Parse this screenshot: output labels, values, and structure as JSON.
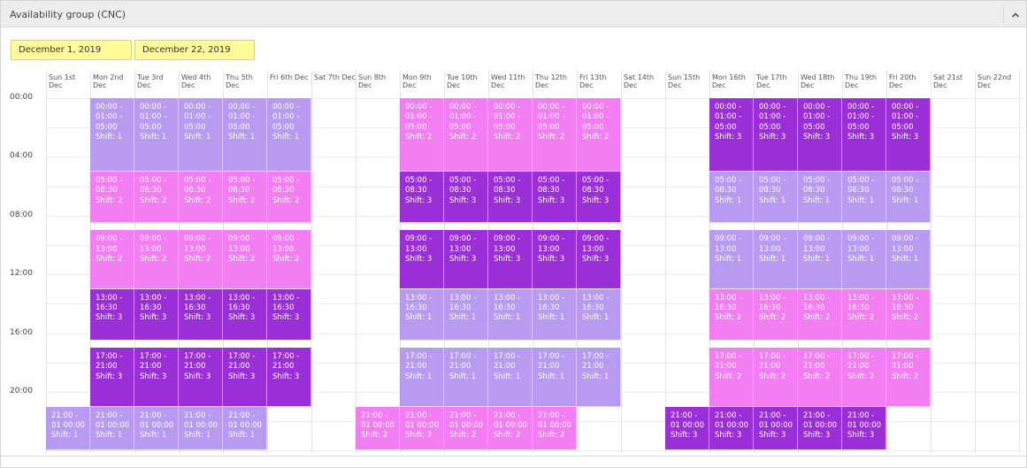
{
  "panel": {
    "title": "Availability group (CNC)"
  },
  "dates": {
    "start": "December 1, 2019",
    "end": "December 22, 2019"
  },
  "days": [
    "Sun 1st Dec",
    "Mon 2nd Dec",
    "Tue 3rd Dec",
    "Wed 4th Dec",
    "Thu 5th Dec",
    "Fri 6th Dec",
    "Sat 7th Dec",
    "Sun 8th Dec",
    "Mon 9th Dec",
    "Tue 10th Dec",
    "Wed 11th Dec",
    "Thu 12th Dec",
    "Fri 13th Dec",
    "Sat 14th Dec",
    "Sun 15th Dec",
    "Mon 16th Dec",
    "Tue 17th Dec",
    "Wed 18th Dec",
    "Thu 19th Dec",
    "Fri 20th Dec",
    "Sat 21st Dec",
    "Sun 22nd Dec"
  ],
  "time_labels": [
    "00:00",
    "04:00",
    "08:00",
    "12:00",
    "16:00",
    "20:00"
  ],
  "shift_colors": {
    "1": "#b99af1",
    "2": "#f37ef3",
    "3": "#9b2fd7"
  },
  "events": [
    {
      "day": 1,
      "s": 0,
      "e": 5,
      "l1": "00:00 -",
      "l2": "01:00 -",
      "l3": "05:00",
      "label": "Shift: 1",
      "shift": 1
    },
    {
      "day": 2,
      "s": 0,
      "e": 5,
      "l1": "00:00 -",
      "l2": "01:00 -",
      "l3": "05:00",
      "label": "Shift: 1",
      "shift": 1
    },
    {
      "day": 3,
      "s": 0,
      "e": 5,
      "l1": "00:00 -",
      "l2": "01:00 -",
      "l3": "05:00",
      "label": "Shift: 1",
      "shift": 1
    },
    {
      "day": 4,
      "s": 0,
      "e": 5,
      "l1": "00:00 -",
      "l2": "01:00 -",
      "l3": "05:00",
      "label": "Shift: 1",
      "shift": 1
    },
    {
      "day": 5,
      "s": 0,
      "e": 5,
      "l1": "00:00 -",
      "l2": "01:00 -",
      "l3": "05:00",
      "label": "Shift: 1",
      "shift": 1
    },
    {
      "day": 8,
      "s": 0,
      "e": 5,
      "l1": "00:00 -",
      "l2": "01:00 -",
      "l3": "05:00",
      "label": "Shift: 2",
      "shift": 2
    },
    {
      "day": 9,
      "s": 0,
      "e": 5,
      "l1": "00:00 -",
      "l2": "01:00 -",
      "l3": "05:00",
      "label": "Shift: 2",
      "shift": 2
    },
    {
      "day": 10,
      "s": 0,
      "e": 5,
      "l1": "00:00 -",
      "l2": "01:00 -",
      "l3": "05:00",
      "label": "Shift: 2",
      "shift": 2
    },
    {
      "day": 11,
      "s": 0,
      "e": 5,
      "l1": "00:00 -",
      "l2": "01:00 -",
      "l3": "05:00",
      "label": "Shift: 2",
      "shift": 2
    },
    {
      "day": 12,
      "s": 0,
      "e": 5,
      "l1": "00:00 -",
      "l2": "01:00 -",
      "l3": "05:00",
      "label": "Shift: 2",
      "shift": 2
    },
    {
      "day": 15,
      "s": 0,
      "e": 5,
      "l1": "00:00 -",
      "l2": "01:00 -",
      "l3": "05:00",
      "label": "Shift: 3",
      "shift": 3
    },
    {
      "day": 16,
      "s": 0,
      "e": 5,
      "l1": "00:00 -",
      "l2": "01:00 -",
      "l3": "05:00",
      "label": "Shift: 3",
      "shift": 3
    },
    {
      "day": 17,
      "s": 0,
      "e": 5,
      "l1": "00:00 -",
      "l2": "01:00 -",
      "l3": "05:00",
      "label": "Shift: 3",
      "shift": 3
    },
    {
      "day": 18,
      "s": 0,
      "e": 5,
      "l1": "00:00 -",
      "l2": "01:00 -",
      "l3": "05:00",
      "label": "Shift: 3",
      "shift": 3
    },
    {
      "day": 19,
      "s": 0,
      "e": 5,
      "l1": "00:00 -",
      "l2": "01:00 -",
      "l3": "05:00",
      "label": "Shift: 3",
      "shift": 3
    },
    {
      "day": 1,
      "s": 5,
      "e": 8.5,
      "l1": "05:00 -",
      "l2": "08:30",
      "l3": "",
      "label": "Shift: 2",
      "shift": 2
    },
    {
      "day": 2,
      "s": 5,
      "e": 8.5,
      "l1": "05:00 -",
      "l2": "08:30",
      "l3": "",
      "label": "Shift: 2",
      "shift": 2
    },
    {
      "day": 3,
      "s": 5,
      "e": 8.5,
      "l1": "05:00 -",
      "l2": "08:30",
      "l3": "",
      "label": "Shift: 2",
      "shift": 2
    },
    {
      "day": 4,
      "s": 5,
      "e": 8.5,
      "l1": "05:00 -",
      "l2": "08:30",
      "l3": "",
      "label": "Shift: 2",
      "shift": 2
    },
    {
      "day": 5,
      "s": 5,
      "e": 8.5,
      "l1": "05:00 -",
      "l2": "08:30",
      "l3": "",
      "label": "Shift: 2",
      "shift": 2
    },
    {
      "day": 8,
      "s": 5,
      "e": 8.5,
      "l1": "05:00 -",
      "l2": "08:30",
      "l3": "",
      "label": "Shift: 3",
      "shift": 3
    },
    {
      "day": 9,
      "s": 5,
      "e": 8.5,
      "l1": "05:00 -",
      "l2": "08:30",
      "l3": "",
      "label": "Shift: 3",
      "shift": 3
    },
    {
      "day": 10,
      "s": 5,
      "e": 8.5,
      "l1": "05:00 -",
      "l2": "08:30",
      "l3": "",
      "label": "Shift: 3",
      "shift": 3
    },
    {
      "day": 11,
      "s": 5,
      "e": 8.5,
      "l1": "05:00 -",
      "l2": "08:30",
      "l3": "",
      "label": "Shift: 3",
      "shift": 3
    },
    {
      "day": 12,
      "s": 5,
      "e": 8.5,
      "l1": "05:00 -",
      "l2": "08:30",
      "l3": "",
      "label": "Shift: 3",
      "shift": 3
    },
    {
      "day": 15,
      "s": 5,
      "e": 8.5,
      "l1": "05:00 -",
      "l2": "08:30",
      "l3": "",
      "label": "Shift: 1",
      "shift": 1
    },
    {
      "day": 16,
      "s": 5,
      "e": 8.5,
      "l1": "05:00 -",
      "l2": "08:30",
      "l3": "",
      "label": "Shift: 1",
      "shift": 1
    },
    {
      "day": 17,
      "s": 5,
      "e": 8.5,
      "l1": "05:00 -",
      "l2": "08:30",
      "l3": "",
      "label": "Shift: 1",
      "shift": 1
    },
    {
      "day": 18,
      "s": 5,
      "e": 8.5,
      "l1": "05:00 -",
      "l2": "08:30",
      "l3": "",
      "label": "Shift: 1",
      "shift": 1
    },
    {
      "day": 19,
      "s": 5,
      "e": 8.5,
      "l1": "05:00 -",
      "l2": "08:30",
      "l3": "",
      "label": "Shift: 1",
      "shift": 1
    },
    {
      "day": 1,
      "s": 9,
      "e": 13,
      "l1": "09:00 -",
      "l2": "13:00",
      "l3": "",
      "label": "Shift: 2",
      "shift": 2
    },
    {
      "day": 2,
      "s": 9,
      "e": 13,
      "l1": "09:00 -",
      "l2": "13:00",
      "l3": "",
      "label": "Shift: 2",
      "shift": 2
    },
    {
      "day": 3,
      "s": 9,
      "e": 13,
      "l1": "09:00 -",
      "l2": "13:00",
      "l3": "",
      "label": "Shift: 2",
      "shift": 2
    },
    {
      "day": 4,
      "s": 9,
      "e": 13,
      "l1": "09:00 -",
      "l2": "13:00",
      "l3": "",
      "label": "Shift: 2",
      "shift": 2
    },
    {
      "day": 5,
      "s": 9,
      "e": 13,
      "l1": "09:00 -",
      "l2": "13:00",
      "l3": "",
      "label": "Shift: 2",
      "shift": 2
    },
    {
      "day": 8,
      "s": 9,
      "e": 13,
      "l1": "09:00 -",
      "l2": "13:00",
      "l3": "",
      "label": "Shift: 3",
      "shift": 3
    },
    {
      "day": 9,
      "s": 9,
      "e": 13,
      "l1": "09:00 -",
      "l2": "13:00",
      "l3": "",
      "label": "Shift: 3",
      "shift": 3
    },
    {
      "day": 10,
      "s": 9,
      "e": 13,
      "l1": "09:00 -",
      "l2": "13:00",
      "l3": "",
      "label": "Shift: 3",
      "shift": 3
    },
    {
      "day": 11,
      "s": 9,
      "e": 13,
      "l1": "09:00 -",
      "l2": "13:00",
      "l3": "",
      "label": "Shift: 3",
      "shift": 3
    },
    {
      "day": 12,
      "s": 9,
      "e": 13,
      "l1": "09:00 -",
      "l2": "13:00",
      "l3": "",
      "label": "Shift: 3",
      "shift": 3
    },
    {
      "day": 15,
      "s": 9,
      "e": 13,
      "l1": "09:00 -",
      "l2": "13:00",
      "l3": "",
      "label": "Shift: 1",
      "shift": 1
    },
    {
      "day": 16,
      "s": 9,
      "e": 13,
      "l1": "09:00 -",
      "l2": "13:00",
      "l3": "",
      "label": "Shift: 1",
      "shift": 1
    },
    {
      "day": 17,
      "s": 9,
      "e": 13,
      "l1": "09:00 -",
      "l2": "13:00",
      "l3": "",
      "label": "Shift: 1",
      "shift": 1
    },
    {
      "day": 18,
      "s": 9,
      "e": 13,
      "l1": "09:00 -",
      "l2": "13:00",
      "l3": "",
      "label": "Shift: 1",
      "shift": 1
    },
    {
      "day": 19,
      "s": 9,
      "e": 13,
      "l1": "09:00 -",
      "l2": "13:00",
      "l3": "",
      "label": "Shift: 1",
      "shift": 1
    },
    {
      "day": 1,
      "s": 13,
      "e": 16.5,
      "l1": "13:00 -",
      "l2": "16:30",
      "l3": "",
      "label": "Shift: 3",
      "shift": 3
    },
    {
      "day": 2,
      "s": 13,
      "e": 16.5,
      "l1": "13:00 -",
      "l2": "16:30",
      "l3": "",
      "label": "Shift: 3",
      "shift": 3
    },
    {
      "day": 3,
      "s": 13,
      "e": 16.5,
      "l1": "13:00 -",
      "l2": "16:30",
      "l3": "",
      "label": "Shift: 3",
      "shift": 3
    },
    {
      "day": 4,
      "s": 13,
      "e": 16.5,
      "l1": "13:00 -",
      "l2": "16:30",
      "l3": "",
      "label": "Shift: 3",
      "shift": 3
    },
    {
      "day": 5,
      "s": 13,
      "e": 16.5,
      "l1": "13:00 -",
      "l2": "16:30",
      "l3": "",
      "label": "Shift: 3",
      "shift": 3
    },
    {
      "day": 8,
      "s": 13,
      "e": 16.5,
      "l1": "13:00 -",
      "l2": "16:30",
      "l3": "",
      "label": "Shift: 1",
      "shift": 1
    },
    {
      "day": 9,
      "s": 13,
      "e": 16.5,
      "l1": "13:00 -",
      "l2": "16:30",
      "l3": "",
      "label": "Shift: 1",
      "shift": 1
    },
    {
      "day": 10,
      "s": 13,
      "e": 16.5,
      "l1": "13:00 -",
      "l2": "16:30",
      "l3": "",
      "label": "Shift: 1",
      "shift": 1
    },
    {
      "day": 11,
      "s": 13,
      "e": 16.5,
      "l1": "13:00 -",
      "l2": "16:30",
      "l3": "",
      "label": "Shift: 1",
      "shift": 1
    },
    {
      "day": 12,
      "s": 13,
      "e": 16.5,
      "l1": "13:00 -",
      "l2": "16:30",
      "l3": "",
      "label": "Shift: 1",
      "shift": 1
    },
    {
      "day": 15,
      "s": 13,
      "e": 16.5,
      "l1": "13:00 -",
      "l2": "16:30",
      "l3": "",
      "label": "Shift: 2",
      "shift": 2
    },
    {
      "day": 16,
      "s": 13,
      "e": 16.5,
      "l1": "13:00 -",
      "l2": "16:30",
      "l3": "",
      "label": "Shift: 2",
      "shift": 2
    },
    {
      "day": 17,
      "s": 13,
      "e": 16.5,
      "l1": "13:00 -",
      "l2": "16:30",
      "l3": "",
      "label": "Shift: 2",
      "shift": 2
    },
    {
      "day": 18,
      "s": 13,
      "e": 16.5,
      "l1": "13:00 -",
      "l2": "16:30",
      "l3": "",
      "label": "Shift: 2",
      "shift": 2
    },
    {
      "day": 19,
      "s": 13,
      "e": 16.5,
      "l1": "13:00 -",
      "l2": "16:30",
      "l3": "",
      "label": "Shift: 2",
      "shift": 2
    },
    {
      "day": 1,
      "s": 17,
      "e": 21,
      "l1": "17:00 -",
      "l2": "21:00",
      "l3": "",
      "label": "Shift: 3",
      "shift": 3
    },
    {
      "day": 2,
      "s": 17,
      "e": 21,
      "l1": "17:00 -",
      "l2": "21:00",
      "l3": "",
      "label": "Shift: 3",
      "shift": 3
    },
    {
      "day": 3,
      "s": 17,
      "e": 21,
      "l1": "17:00 -",
      "l2": "21:00",
      "l3": "",
      "label": "Shift: 3",
      "shift": 3
    },
    {
      "day": 4,
      "s": 17,
      "e": 21,
      "l1": "17:00 -",
      "l2": "21:00",
      "l3": "",
      "label": "Shift: 3",
      "shift": 3
    },
    {
      "day": 5,
      "s": 17,
      "e": 21,
      "l1": "17:00 -",
      "l2": "21:00",
      "l3": "",
      "label": "Shift: 3",
      "shift": 3
    },
    {
      "day": 8,
      "s": 17,
      "e": 21,
      "l1": "17:00 -",
      "l2": "21:00",
      "l3": "",
      "label": "Shift: 1",
      "shift": 1
    },
    {
      "day": 9,
      "s": 17,
      "e": 21,
      "l1": "17:00 -",
      "l2": "21:00",
      "l3": "",
      "label": "Shift: 1",
      "shift": 1
    },
    {
      "day": 10,
      "s": 17,
      "e": 21,
      "l1": "17:00 -",
      "l2": "21:00",
      "l3": "",
      "label": "Shift: 1",
      "shift": 1
    },
    {
      "day": 11,
      "s": 17,
      "e": 21,
      "l1": "17:00 -",
      "l2": "21:00",
      "l3": "",
      "label": "Shift: 1",
      "shift": 1
    },
    {
      "day": 12,
      "s": 17,
      "e": 21,
      "l1": "17:00 -",
      "l2": "21:00",
      "l3": "",
      "label": "Shift: 1",
      "shift": 1
    },
    {
      "day": 15,
      "s": 17,
      "e": 21,
      "l1": "17:00 -",
      "l2": "21:00",
      "l3": "",
      "label": "Shift: 2",
      "shift": 2
    },
    {
      "day": 16,
      "s": 17,
      "e": 21,
      "l1": "17:00 -",
      "l2": "21:00",
      "l3": "",
      "label": "Shift: 2",
      "shift": 2
    },
    {
      "day": 17,
      "s": 17,
      "e": 21,
      "l1": "17:00 -",
      "l2": "21:00",
      "l3": "",
      "label": "Shift: 2",
      "shift": 2
    },
    {
      "day": 18,
      "s": 17,
      "e": 21,
      "l1": "17:00 -",
      "l2": "21:00",
      "l3": "",
      "label": "Shift: 2",
      "shift": 2
    },
    {
      "day": 19,
      "s": 17,
      "e": 21,
      "l1": "17:00 -",
      "l2": "21:00",
      "l3": "",
      "label": "Shift: 2",
      "shift": 2
    },
    {
      "day": 0,
      "s": 21,
      "e": 24,
      "l1": "21:00 -",
      "l2": "01 00:00",
      "l3": "",
      "label": "Shift: 1",
      "shift": 1
    },
    {
      "day": 1,
      "s": 21,
      "e": 24,
      "l1": "21:00 -",
      "l2": "01 00:00",
      "l3": "",
      "label": "Shift: 1",
      "shift": 1
    },
    {
      "day": 2,
      "s": 21,
      "e": 24,
      "l1": "21:00 -",
      "l2": "01 00:00",
      "l3": "",
      "label": "Shift: 1",
      "shift": 1
    },
    {
      "day": 3,
      "s": 21,
      "e": 24,
      "l1": "21:00 -",
      "l2": "01 00:00",
      "l3": "",
      "label": "Shift: 1",
      "shift": 1
    },
    {
      "day": 4,
      "s": 21,
      "e": 24,
      "l1": "21:00 -",
      "l2": "01 00:00",
      "l3": "",
      "label": "Shift: 1",
      "shift": 1
    },
    {
      "day": 7,
      "s": 21,
      "e": 24,
      "l1": "21:00 -",
      "l2": "01 00:00",
      "l3": "",
      "label": "Shift: 2",
      "shift": 2
    },
    {
      "day": 8,
      "s": 21,
      "e": 24,
      "l1": "21:00 -",
      "l2": "01 00:00",
      "l3": "",
      "label": "Shift: 2",
      "shift": 2
    },
    {
      "day": 9,
      "s": 21,
      "e": 24,
      "l1": "21:00 -",
      "l2": "01 00:00",
      "l3": "",
      "label": "Shift: 2",
      "shift": 2
    },
    {
      "day": 10,
      "s": 21,
      "e": 24,
      "l1": "21:00 -",
      "l2": "01 00:00",
      "l3": "",
      "label": "Shift: 2",
      "shift": 2
    },
    {
      "day": 11,
      "s": 21,
      "e": 24,
      "l1": "21:00 -",
      "l2": "01 00:00",
      "l3": "",
      "label": "Shift: 2",
      "shift": 2
    },
    {
      "day": 14,
      "s": 21,
      "e": 24,
      "l1": "21:00 -",
      "l2": "01 00:00",
      "l3": "",
      "label": "Shift: 3",
      "shift": 3
    },
    {
      "day": 15,
      "s": 21,
      "e": 24,
      "l1": "21:00 -",
      "l2": "01 00:00",
      "l3": "",
      "label": "Shift: 3",
      "shift": 3
    },
    {
      "day": 16,
      "s": 21,
      "e": 24,
      "l1": "21:00 -",
      "l2": "01 00:00",
      "l3": "",
      "label": "Shift: 3",
      "shift": 3
    },
    {
      "day": 17,
      "s": 21,
      "e": 24,
      "l1": "21:00 -",
      "l2": "01 00:00",
      "l3": "",
      "label": "Shift: 3",
      "shift": 3
    },
    {
      "day": 18,
      "s": 21,
      "e": 24,
      "l1": "21:00 -",
      "l2": "01 00:00",
      "l3": "",
      "label": "Shift: 3",
      "shift": 3
    }
  ]
}
